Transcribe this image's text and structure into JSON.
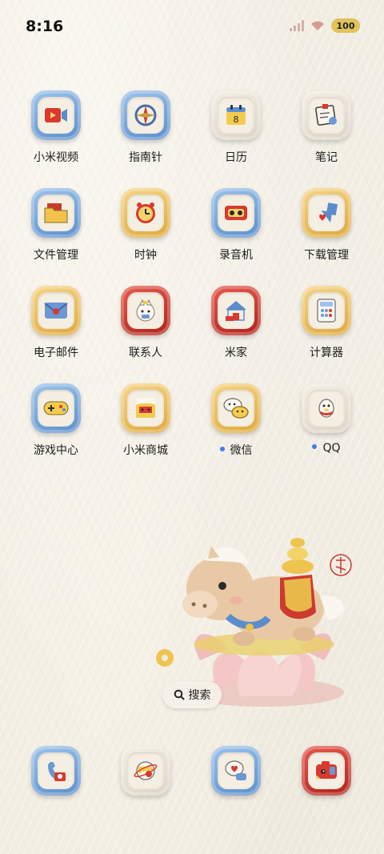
{
  "status_bar": {
    "time": "8:16",
    "battery": "100",
    "icons": [
      "signal-icon",
      "wifi-icon",
      "battery-icon"
    ]
  },
  "apps": [
    {
      "label": "小米视频",
      "icon": "video-icon",
      "frame": "blue"
    },
    {
      "label": "指南针",
      "icon": "compass-icon",
      "frame": "blue"
    },
    {
      "label": "日历",
      "icon": "calendar-icon",
      "frame": "cream",
      "calendar_day": "8"
    },
    {
      "label": "笔记",
      "icon": "notes-icon",
      "frame": "cream"
    },
    {
      "label": "文件管理",
      "icon": "folder-icon",
      "frame": "blue"
    },
    {
      "label": "时钟",
      "icon": "clock-icon",
      "frame": "yellow"
    },
    {
      "label": "录音机",
      "icon": "recorder-icon",
      "frame": "blue"
    },
    {
      "label": "下载管理",
      "icon": "download-icon",
      "frame": "yellow"
    },
    {
      "label": "电子邮件",
      "icon": "mail-icon",
      "frame": "yellow"
    },
    {
      "label": "联系人",
      "icon": "contacts-icon",
      "frame": "red"
    },
    {
      "label": "米家",
      "icon": "home-icon",
      "frame": "red"
    },
    {
      "label": "计算器",
      "icon": "calculator-icon",
      "frame": "yellow"
    },
    {
      "label": "游戏中心",
      "icon": "gamepad-icon",
      "frame": "blue"
    },
    {
      "label": "小米商城",
      "icon": "store-icon",
      "frame": "yellow"
    },
    {
      "label": "微信",
      "icon": "wechat-icon",
      "frame": "yellow",
      "new_dot": true
    },
    {
      "label": "QQ",
      "icon": "qq-icon",
      "frame": "cream",
      "new_dot": true
    }
  ],
  "widget": {
    "search_label": "搜索",
    "art": "horse-on-lotus-illustration"
  },
  "dock": [
    {
      "icon": "phone-icon",
      "frame": "blue"
    },
    {
      "icon": "browser-icon",
      "frame": "cream"
    },
    {
      "icon": "messages-icon",
      "frame": "blue"
    },
    {
      "icon": "camera-icon",
      "frame": "red"
    }
  ],
  "colors": {
    "wallpaper": "#f1ece2",
    "blue_frame": "#7aa8dc",
    "yellow_frame": "#eabf5a",
    "red_frame": "#cc3a30",
    "notification_dot": "#3f7ee8"
  }
}
